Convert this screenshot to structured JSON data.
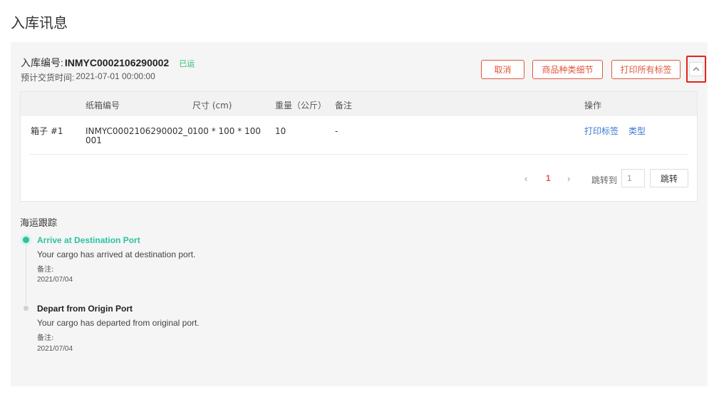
{
  "page": {
    "title": "入库讯息"
  },
  "order": {
    "label": "入库编号:",
    "number": "INMYC0002106290002",
    "status": "已运",
    "eta_label": "预计交货时间:",
    "eta_value": "2021-07-01 00:00:00"
  },
  "actions": {
    "cancel": "取消",
    "product_details": "商品种类细节",
    "print_all_labels": "打印所有标签",
    "collapse_icon": "chevron-up-icon"
  },
  "table": {
    "headers": [
      "纸箱编号",
      "尺寸 (cm)",
      "重量（公斤）",
      "备注",
      "操作"
    ],
    "rows": [
      {
        "name": "箱子 #1",
        "carton_no_line1": "INMYC0002106290002_0",
        "carton_no_line2": "001",
        "size": "100 * 100 * 100",
        "weight": "10",
        "remark": "-",
        "action_print": "打印标签",
        "action_type": "类型"
      }
    ]
  },
  "pagination": {
    "prev": "‹",
    "current": "1",
    "next": "›",
    "jump_label": "跳转到",
    "jump_value": "1",
    "jump_button": "跳转"
  },
  "tracking": {
    "title": "海运跟踪",
    "events": [
      {
        "title": "Arrive at Destination Port",
        "desc": "Your cargo has arrived at destination port.",
        "note": "备注:",
        "date": "2021/07/04"
      },
      {
        "title": "Depart from Origin Port",
        "desc": "Your cargo has departed from original port.",
        "note": "备注:",
        "date": "2021/07/04"
      }
    ]
  },
  "colors": {
    "accent": "#e0573e",
    "status_green": "#2bbd6e",
    "timeline_active": "#2bc2a0",
    "link_blue": "#3b78d6",
    "highlight_red": "#e5231b"
  }
}
